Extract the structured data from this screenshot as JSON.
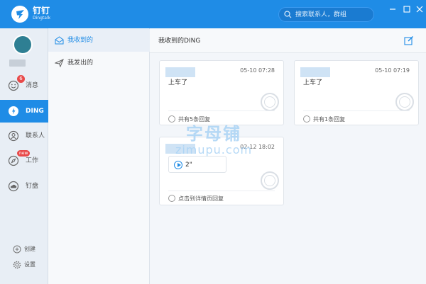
{
  "app": {
    "name": "钉钉",
    "subtitle": "Dingtalk"
  },
  "search": {
    "placeholder": "搜索联系人，群组"
  },
  "nav": {
    "items": [
      {
        "label": "消息",
        "badge": "6"
      },
      {
        "label": "DING"
      },
      {
        "label": "联系人"
      },
      {
        "label": "工作",
        "badge": "new"
      },
      {
        "label": "钉盘"
      }
    ],
    "bottom": [
      {
        "label": "创建"
      },
      {
        "label": "设置"
      }
    ]
  },
  "subnav": {
    "items": [
      {
        "label": "我收到的"
      },
      {
        "label": "我发出的"
      }
    ]
  },
  "main": {
    "title": "我收到的DING",
    "cards": [
      {
        "time": "05-10 07:28",
        "content": "上车了",
        "reply": "共有5条回复"
      },
      {
        "time": "05-10 07:19",
        "content": "上车了",
        "reply": "共有1条回复"
      },
      {
        "time": "02-12 18:02",
        "voice": "2\"",
        "reply": "点击到详情页回复"
      }
    ]
  },
  "watermark": {
    "cn": "字母铺",
    "en": "zimupu.com"
  },
  "colors": {
    "accent": "#1f8ce6",
    "badge": "#e84a4a"
  }
}
